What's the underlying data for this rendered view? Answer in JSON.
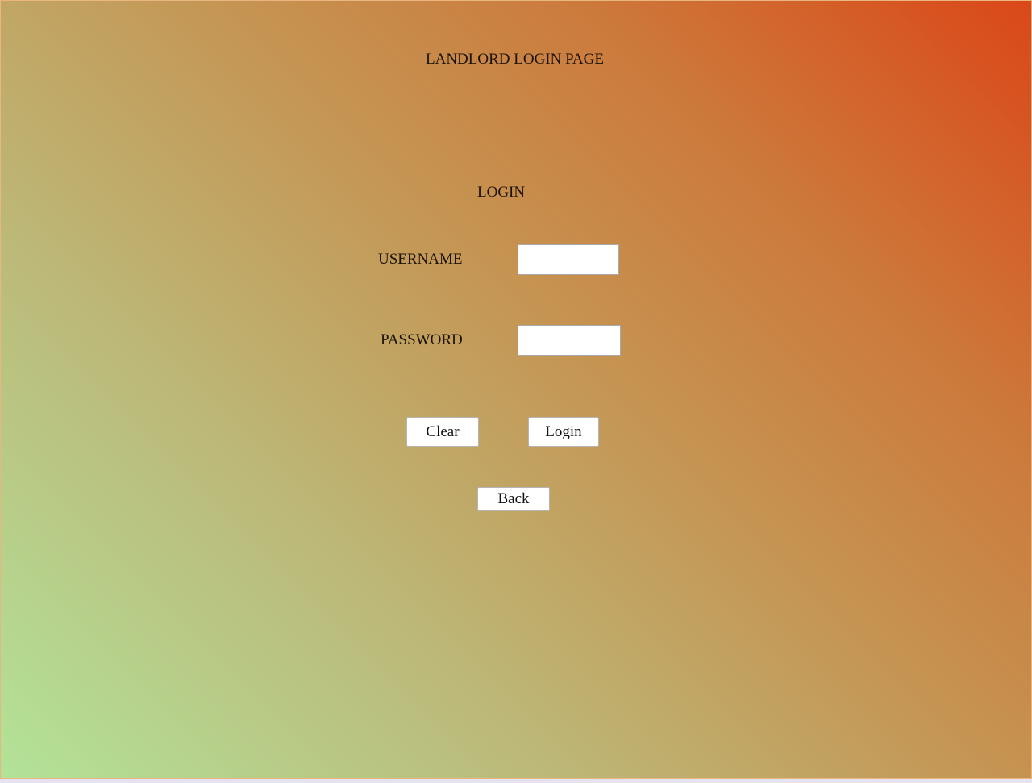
{
  "page": {
    "title": "LANDLORD LOGIN PAGE"
  },
  "form": {
    "heading": "LOGIN",
    "username_label": "USERNAME",
    "username_value": "",
    "password_label": "PASSWORD",
    "password_value": ""
  },
  "buttons": {
    "clear": "Clear",
    "login": "Login",
    "back": "Back"
  },
  "colors": {
    "gradient_start": "#b2e398",
    "gradient_end": "#db4718",
    "border": "#e8b67e"
  }
}
